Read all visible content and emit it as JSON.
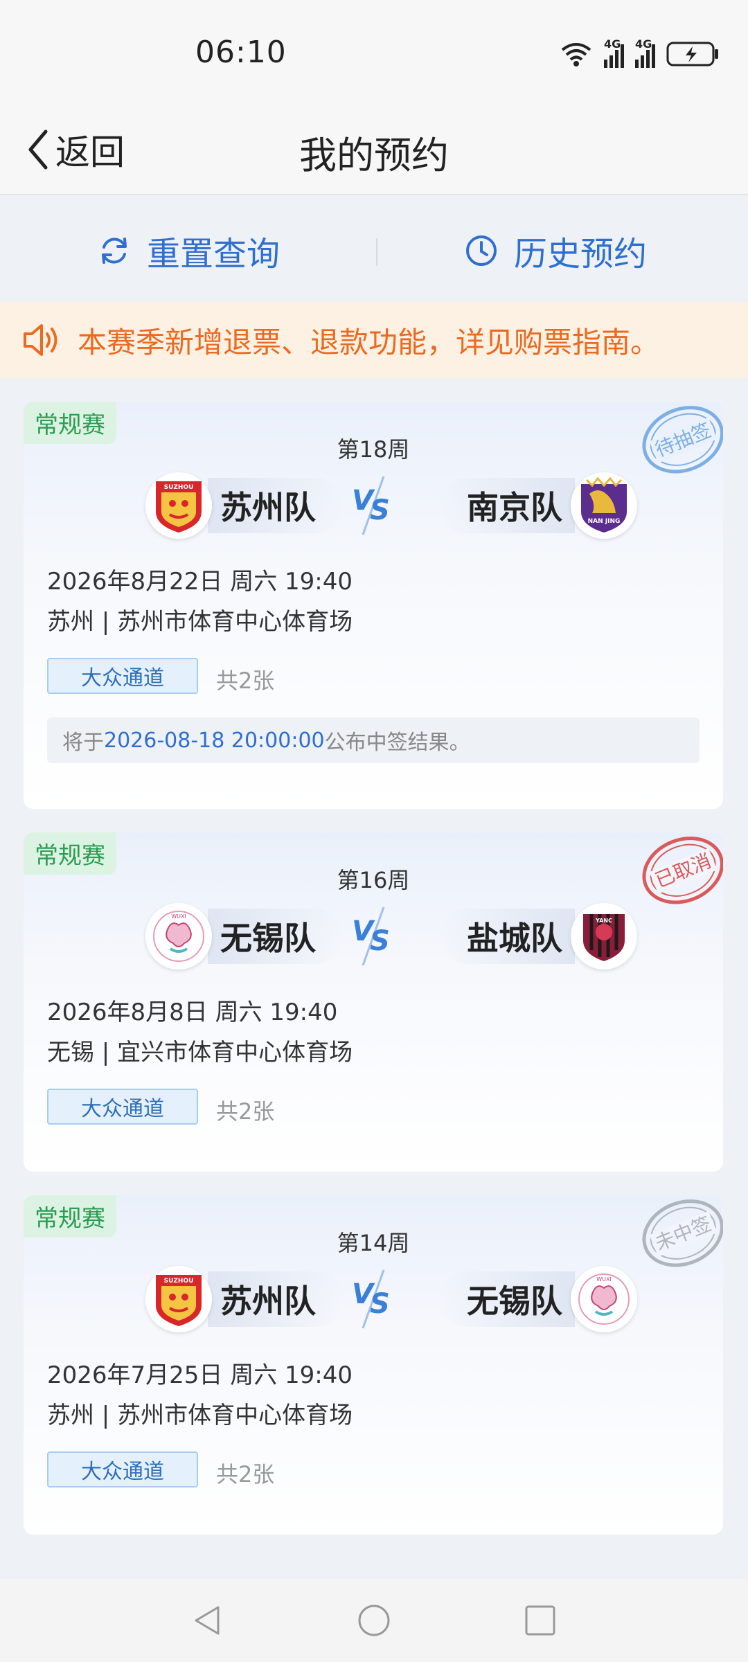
{
  "status": {
    "time": "06:10",
    "net1": "4G",
    "net2": "4G"
  },
  "header": {
    "back_label": "返回",
    "title": "我的预约"
  },
  "actions": {
    "reset": "重置查询",
    "history": "历史预约"
  },
  "notice": "本赛季新增退票、退款功能，详见购票指南。",
  "cards": [
    {
      "badge": "常规赛",
      "round": "第18周",
      "home": "苏州队",
      "away": "南京队",
      "datetime": "2026年8月22日 周六 19:40",
      "venue": "苏州 | 苏州市体育中心体育场",
      "gate": "大众通道",
      "count": "共2张",
      "note_prefix": "将于",
      "note_time": "2026-08-18 20:00:00",
      "note_suffix": "公布中签结果。",
      "stamp": "待抽签",
      "stamp_color": "#6aa4e0"
    },
    {
      "badge": "常规赛",
      "round": "第16周",
      "home": "无锡队",
      "away": "盐城队",
      "datetime": "2026年8月8日 周六 19:40",
      "venue": "无锡 | 宜兴市体育中心体育场",
      "gate": "大众通道",
      "count": "共2张",
      "stamp": "已取消",
      "stamp_color": "#d74a4a"
    },
    {
      "badge": "常规赛",
      "round": "第14周",
      "home": "苏州队",
      "away": "无锡队",
      "datetime": "2026年7月25日 周六 19:40",
      "venue": "苏州 | 苏州市体育中心体育场",
      "gate": "大众通道",
      "count": "共2张",
      "stamp": "未中签",
      "stamp_color": "#a9aeb8"
    }
  ],
  "logos": {
    "suzhou": "SUZHOU",
    "nanjing": "NAN JING",
    "wuxi": "WUXI",
    "yancheng": "YANC"
  },
  "colors": {
    "accent": "#2f6fd0",
    "notice": "#ec6a1f",
    "badge": "#2b9c52"
  }
}
